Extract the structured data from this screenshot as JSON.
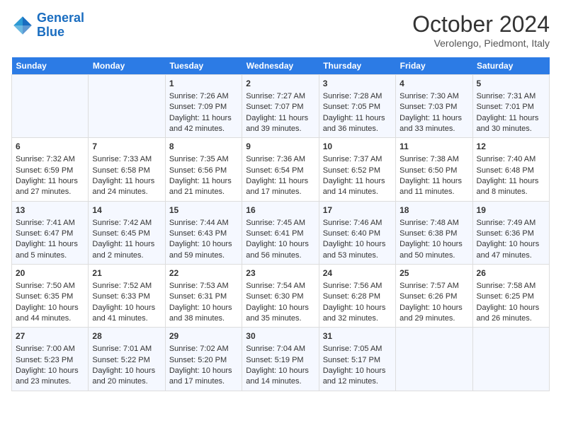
{
  "header": {
    "logo_line1": "General",
    "logo_line2": "Blue",
    "month": "October 2024",
    "location": "Verolengo, Piedmont, Italy"
  },
  "weekdays": [
    "Sunday",
    "Monday",
    "Tuesday",
    "Wednesday",
    "Thursday",
    "Friday",
    "Saturday"
  ],
  "weeks": [
    [
      {
        "day": "",
        "info": ""
      },
      {
        "day": "",
        "info": ""
      },
      {
        "day": "1",
        "info": "Sunrise: 7:26 AM\nSunset: 7:09 PM\nDaylight: 11 hours and 42 minutes."
      },
      {
        "day": "2",
        "info": "Sunrise: 7:27 AM\nSunset: 7:07 PM\nDaylight: 11 hours and 39 minutes."
      },
      {
        "day": "3",
        "info": "Sunrise: 7:28 AM\nSunset: 7:05 PM\nDaylight: 11 hours and 36 minutes."
      },
      {
        "day": "4",
        "info": "Sunrise: 7:30 AM\nSunset: 7:03 PM\nDaylight: 11 hours and 33 minutes."
      },
      {
        "day": "5",
        "info": "Sunrise: 7:31 AM\nSunset: 7:01 PM\nDaylight: 11 hours and 30 minutes."
      }
    ],
    [
      {
        "day": "6",
        "info": "Sunrise: 7:32 AM\nSunset: 6:59 PM\nDaylight: 11 hours and 27 minutes."
      },
      {
        "day": "7",
        "info": "Sunrise: 7:33 AM\nSunset: 6:58 PM\nDaylight: 11 hours and 24 minutes."
      },
      {
        "day": "8",
        "info": "Sunrise: 7:35 AM\nSunset: 6:56 PM\nDaylight: 11 hours and 21 minutes."
      },
      {
        "day": "9",
        "info": "Sunrise: 7:36 AM\nSunset: 6:54 PM\nDaylight: 11 hours and 17 minutes."
      },
      {
        "day": "10",
        "info": "Sunrise: 7:37 AM\nSunset: 6:52 PM\nDaylight: 11 hours and 14 minutes."
      },
      {
        "day": "11",
        "info": "Sunrise: 7:38 AM\nSunset: 6:50 PM\nDaylight: 11 hours and 11 minutes."
      },
      {
        "day": "12",
        "info": "Sunrise: 7:40 AM\nSunset: 6:48 PM\nDaylight: 11 hours and 8 minutes."
      }
    ],
    [
      {
        "day": "13",
        "info": "Sunrise: 7:41 AM\nSunset: 6:47 PM\nDaylight: 11 hours and 5 minutes."
      },
      {
        "day": "14",
        "info": "Sunrise: 7:42 AM\nSunset: 6:45 PM\nDaylight: 11 hours and 2 minutes."
      },
      {
        "day": "15",
        "info": "Sunrise: 7:44 AM\nSunset: 6:43 PM\nDaylight: 10 hours and 59 minutes."
      },
      {
        "day": "16",
        "info": "Sunrise: 7:45 AM\nSunset: 6:41 PM\nDaylight: 10 hours and 56 minutes."
      },
      {
        "day": "17",
        "info": "Sunrise: 7:46 AM\nSunset: 6:40 PM\nDaylight: 10 hours and 53 minutes."
      },
      {
        "day": "18",
        "info": "Sunrise: 7:48 AM\nSunset: 6:38 PM\nDaylight: 10 hours and 50 minutes."
      },
      {
        "day": "19",
        "info": "Sunrise: 7:49 AM\nSunset: 6:36 PM\nDaylight: 10 hours and 47 minutes."
      }
    ],
    [
      {
        "day": "20",
        "info": "Sunrise: 7:50 AM\nSunset: 6:35 PM\nDaylight: 10 hours and 44 minutes."
      },
      {
        "day": "21",
        "info": "Sunrise: 7:52 AM\nSunset: 6:33 PM\nDaylight: 10 hours and 41 minutes."
      },
      {
        "day": "22",
        "info": "Sunrise: 7:53 AM\nSunset: 6:31 PM\nDaylight: 10 hours and 38 minutes."
      },
      {
        "day": "23",
        "info": "Sunrise: 7:54 AM\nSunset: 6:30 PM\nDaylight: 10 hours and 35 minutes."
      },
      {
        "day": "24",
        "info": "Sunrise: 7:56 AM\nSunset: 6:28 PM\nDaylight: 10 hours and 32 minutes."
      },
      {
        "day": "25",
        "info": "Sunrise: 7:57 AM\nSunset: 6:26 PM\nDaylight: 10 hours and 29 minutes."
      },
      {
        "day": "26",
        "info": "Sunrise: 7:58 AM\nSunset: 6:25 PM\nDaylight: 10 hours and 26 minutes."
      }
    ],
    [
      {
        "day": "27",
        "info": "Sunrise: 7:00 AM\nSunset: 5:23 PM\nDaylight: 10 hours and 23 minutes."
      },
      {
        "day": "28",
        "info": "Sunrise: 7:01 AM\nSunset: 5:22 PM\nDaylight: 10 hours and 20 minutes."
      },
      {
        "day": "29",
        "info": "Sunrise: 7:02 AM\nSunset: 5:20 PM\nDaylight: 10 hours and 17 minutes."
      },
      {
        "day": "30",
        "info": "Sunrise: 7:04 AM\nSunset: 5:19 PM\nDaylight: 10 hours and 14 minutes."
      },
      {
        "day": "31",
        "info": "Sunrise: 7:05 AM\nSunset: 5:17 PM\nDaylight: 10 hours and 12 minutes."
      },
      {
        "day": "",
        "info": ""
      },
      {
        "day": "",
        "info": ""
      }
    ]
  ]
}
